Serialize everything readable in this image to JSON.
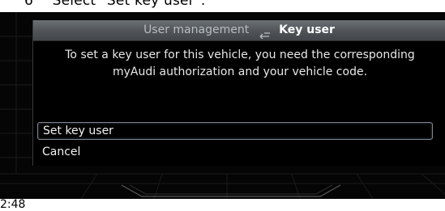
{
  "caption": {
    "step_number": "6",
    "instruction": "Select \"Set key user\"."
  },
  "dialog": {
    "breadcrumb_parent": "User management",
    "back_icon": "return-arrow-icon",
    "title": "Key user",
    "message": "To set a key user for this vehicle, you need the corresponding myAudi authorization and your vehicle code.",
    "options": [
      {
        "label": "Set key user",
        "selected": true
      },
      {
        "label": "Cancel",
        "selected": false
      }
    ]
  },
  "status": {
    "time": "2:48"
  },
  "colors": {
    "screen_background": "#050505",
    "header_gradient_top": "#6b7074",
    "selection_border": "#7d8690",
    "text": "#f2f2f2"
  }
}
